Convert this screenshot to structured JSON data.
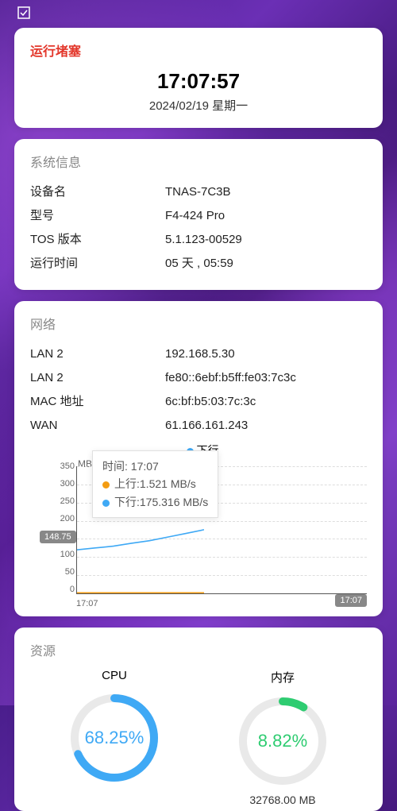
{
  "status": {
    "title": "运行堵塞",
    "time": "17:07:57",
    "date": "2024/02/19 星期一"
  },
  "sysinfo": {
    "title": "系统信息",
    "rows": [
      {
        "key": "设备名",
        "val": "TNAS-7C3B"
      },
      {
        "key": "型号",
        "val": "F4-424 Pro"
      },
      {
        "key": "TOS 版本",
        "val": "5.1.123-00529"
      },
      {
        "key": "运行时间",
        "val": "05 天 , 05:59"
      }
    ]
  },
  "network": {
    "title": "网络",
    "rows": [
      {
        "key": "LAN 2",
        "val": "192.168.5.30"
      },
      {
        "key": "LAN 2",
        "val": "fe80::6ebf:b5ff:fe03:7c3c"
      },
      {
        "key": "MAC 地址",
        "val": "6c:bf:b5:03:7c:3c"
      },
      {
        "key": "WAN",
        "val": "61.166.161.243"
      }
    ],
    "legend": {
      "down_label": "下行"
    },
    "chart_unit": "MB/s",
    "tooltip": {
      "time_label": "时间:",
      "time_value": "17:07",
      "up_label": "上行:",
      "up_value": "1.521 MB/s",
      "down_label": "下行:",
      "down_value": "175.316 MB/s"
    },
    "y_badge": "148.75",
    "x_badge": "17:07",
    "x_start": "17:07"
  },
  "chart_data": {
    "type": "line",
    "title": "",
    "x_unit": "time",
    "y_unit": "MB/s",
    "ylim": [
      0,
      350
    ],
    "y_ticks": [
      0,
      50,
      100,
      150,
      200,
      250,
      300,
      350
    ],
    "x_ticks": [
      "17:07",
      "17:07"
    ],
    "tooltip_time": "17:07",
    "series": [
      {
        "name": "上行",
        "color": "#f39c12",
        "values": [
          1.5,
          1.5,
          1.5,
          1.5,
          1.5,
          1.5,
          1.5,
          1.521
        ]
      },
      {
        "name": "下行",
        "color": "#3fa9f5",
        "values": [
          120,
          125,
          130,
          138,
          145,
          155,
          165,
          175.316
        ]
      }
    ],
    "legend_position": "top",
    "highlight_y": 148.75
  },
  "resources": {
    "title": "资源",
    "cpu": {
      "title": "CPU",
      "percent": 68.25,
      "display": "68.25%"
    },
    "mem": {
      "title": "内存",
      "percent": 8.82,
      "display": "8.82%",
      "total": "32768.00 MB"
    }
  }
}
